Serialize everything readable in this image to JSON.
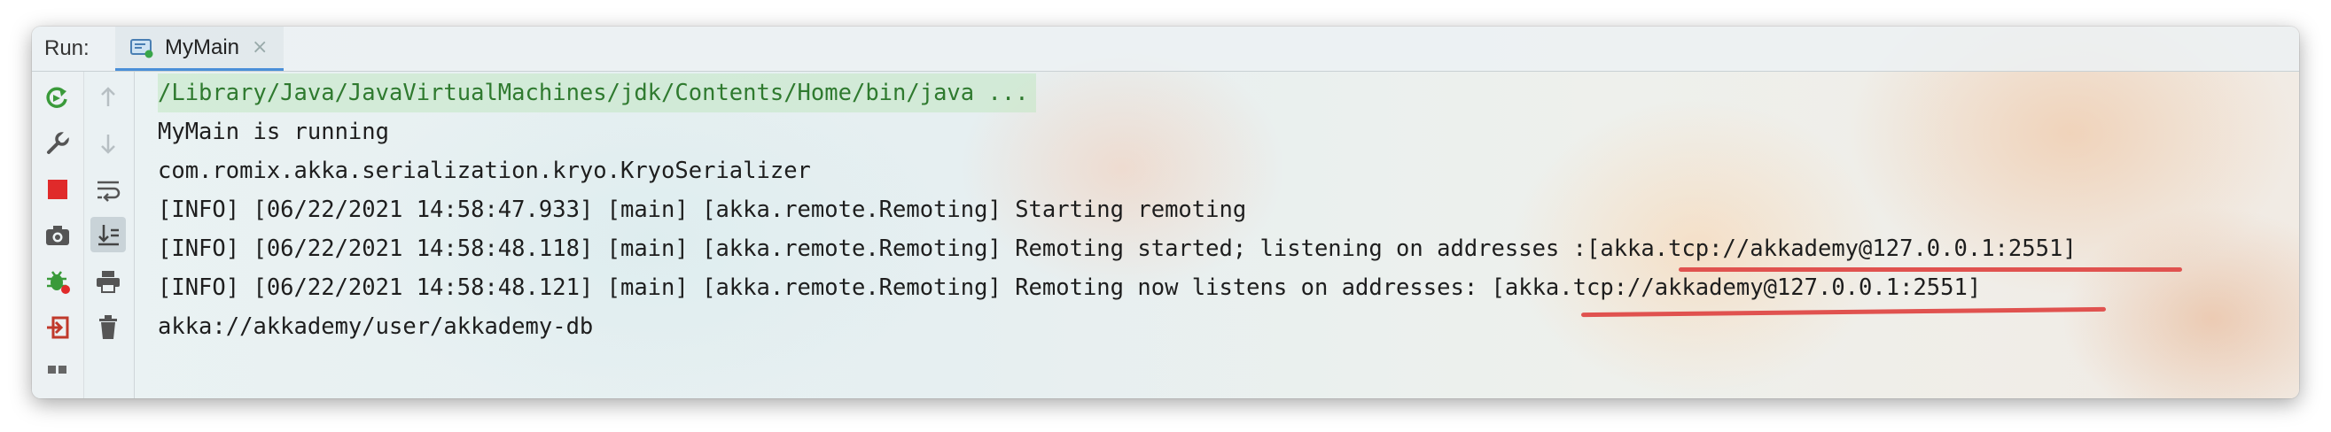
{
  "run_label": "Run:",
  "tab": {
    "name": "MyMain",
    "close": "×"
  },
  "toolbar": {
    "left": [
      "rerun-icon",
      "wrench-icon",
      "stop-icon",
      "camera-icon",
      "debug-bug-icon",
      "login-icon",
      "layout-icon"
    ],
    "right": [
      "up-arrow-icon",
      "down-arrow-icon",
      "soft-wrap-icon",
      "scroll-to-end-icon",
      "print-icon",
      "trash-icon"
    ]
  },
  "console": {
    "lines": [
      "/Library/Java/JavaVirtualMachines/jdk/Contents/Home/bin/java ...",
      "MyMain is running",
      "com.romix.akka.serialization.kryo.KryoSerializer",
      "[INFO] [06/22/2021 14:58:47.933] [main] [akka.remote.Remoting] Starting remoting",
      "[INFO] [06/22/2021 14:58:48.118] [main] [akka.remote.Remoting] Remoting started; listening on addresses :[akka.tcp://akkademy@127.0.0.1:2551]",
      "[INFO] [06/22/2021 14:58:48.121] [main] [akka.remote.Remoting] Remoting now listens on addresses: [akka.tcp://akkademy@127.0.0.1:2551]",
      "akka://akkademy/user/akkademy-db"
    ]
  },
  "colors": {
    "accent_tab": "#4a8fd8",
    "command_text": "#2f7a2f",
    "annotation_red": "#e0524f",
    "rerun_green": "#3a9a3a",
    "stop_red": "#e02a2a"
  }
}
